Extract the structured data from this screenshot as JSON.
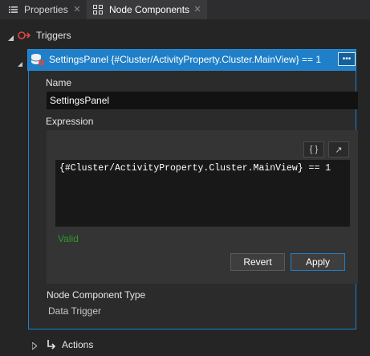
{
  "tabs": [
    {
      "label": "Properties",
      "icon": "list-icon",
      "active": false
    },
    {
      "label": "Node Components",
      "icon": "node-components-icon",
      "active": true
    }
  ],
  "tree": {
    "triggers": {
      "label": "Triggers",
      "icon": "trigger-icon",
      "expanded": true
    },
    "selected_item": {
      "label": "SettingsPanel {#Cluster/ActivityProperty.Cluster.MainView} == 1",
      "icon": "data-trigger-icon",
      "menu_label": "•••"
    },
    "actions": {
      "label": "Actions",
      "icon": "action-arrow-icon",
      "expanded": false
    }
  },
  "properties": {
    "name_label": "Name",
    "name_value": "SettingsPanel",
    "expression_label": "Expression",
    "expression_value": "{#Cluster/ActivityProperty.Cluster.MainView} == 1",
    "braces_button": "{ }",
    "expand_button": "↗",
    "status": "Valid",
    "revert_label": "Revert",
    "apply_label": "Apply",
    "component_type_label": "Node Component Type",
    "component_type_value": "Data Trigger"
  },
  "colors": {
    "selection": "#1f7fc8",
    "valid": "#2d9a2d",
    "trigger_icon": "#e0463c",
    "background": "#252526"
  }
}
